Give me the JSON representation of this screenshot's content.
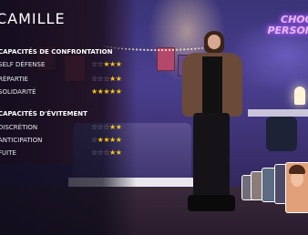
{
  "character": {
    "name": "CAMILLE"
  },
  "neon_sign": {
    "line1": "CHOO",
    "line2": "PERSON"
  },
  "confrontation": {
    "title": "CAPACITÉS DE CONFRONTATION",
    "stats": [
      {
        "label": "SELF DÉFENSE",
        "stars": 3,
        "max": 5
      },
      {
        "label": "RÉPARTIE",
        "stars": 2,
        "max": 5
      },
      {
        "label": "SOLIDARITÉ",
        "stars": 5,
        "max": 5
      }
    ]
  },
  "evitement": {
    "title": "CAPACITÉS D'ÉVITEMENT",
    "stats": [
      {
        "label": "DISCRÉTION",
        "stars": 2,
        "max": 5
      },
      {
        "label": "ANTICIPATION",
        "stars": 4,
        "max": 5
      },
      {
        "label": "FUITE",
        "stars": 2,
        "max": 5
      }
    ]
  },
  "colors": {
    "star_on": "#f5c518",
    "star_off": "#8f8ba3",
    "neon": "#e6b6ff"
  },
  "portraits": [
    "character-portrait-1",
    "character-portrait-2",
    "character-portrait-3",
    "character-portrait-4",
    "character-portrait-5-selected"
  ]
}
